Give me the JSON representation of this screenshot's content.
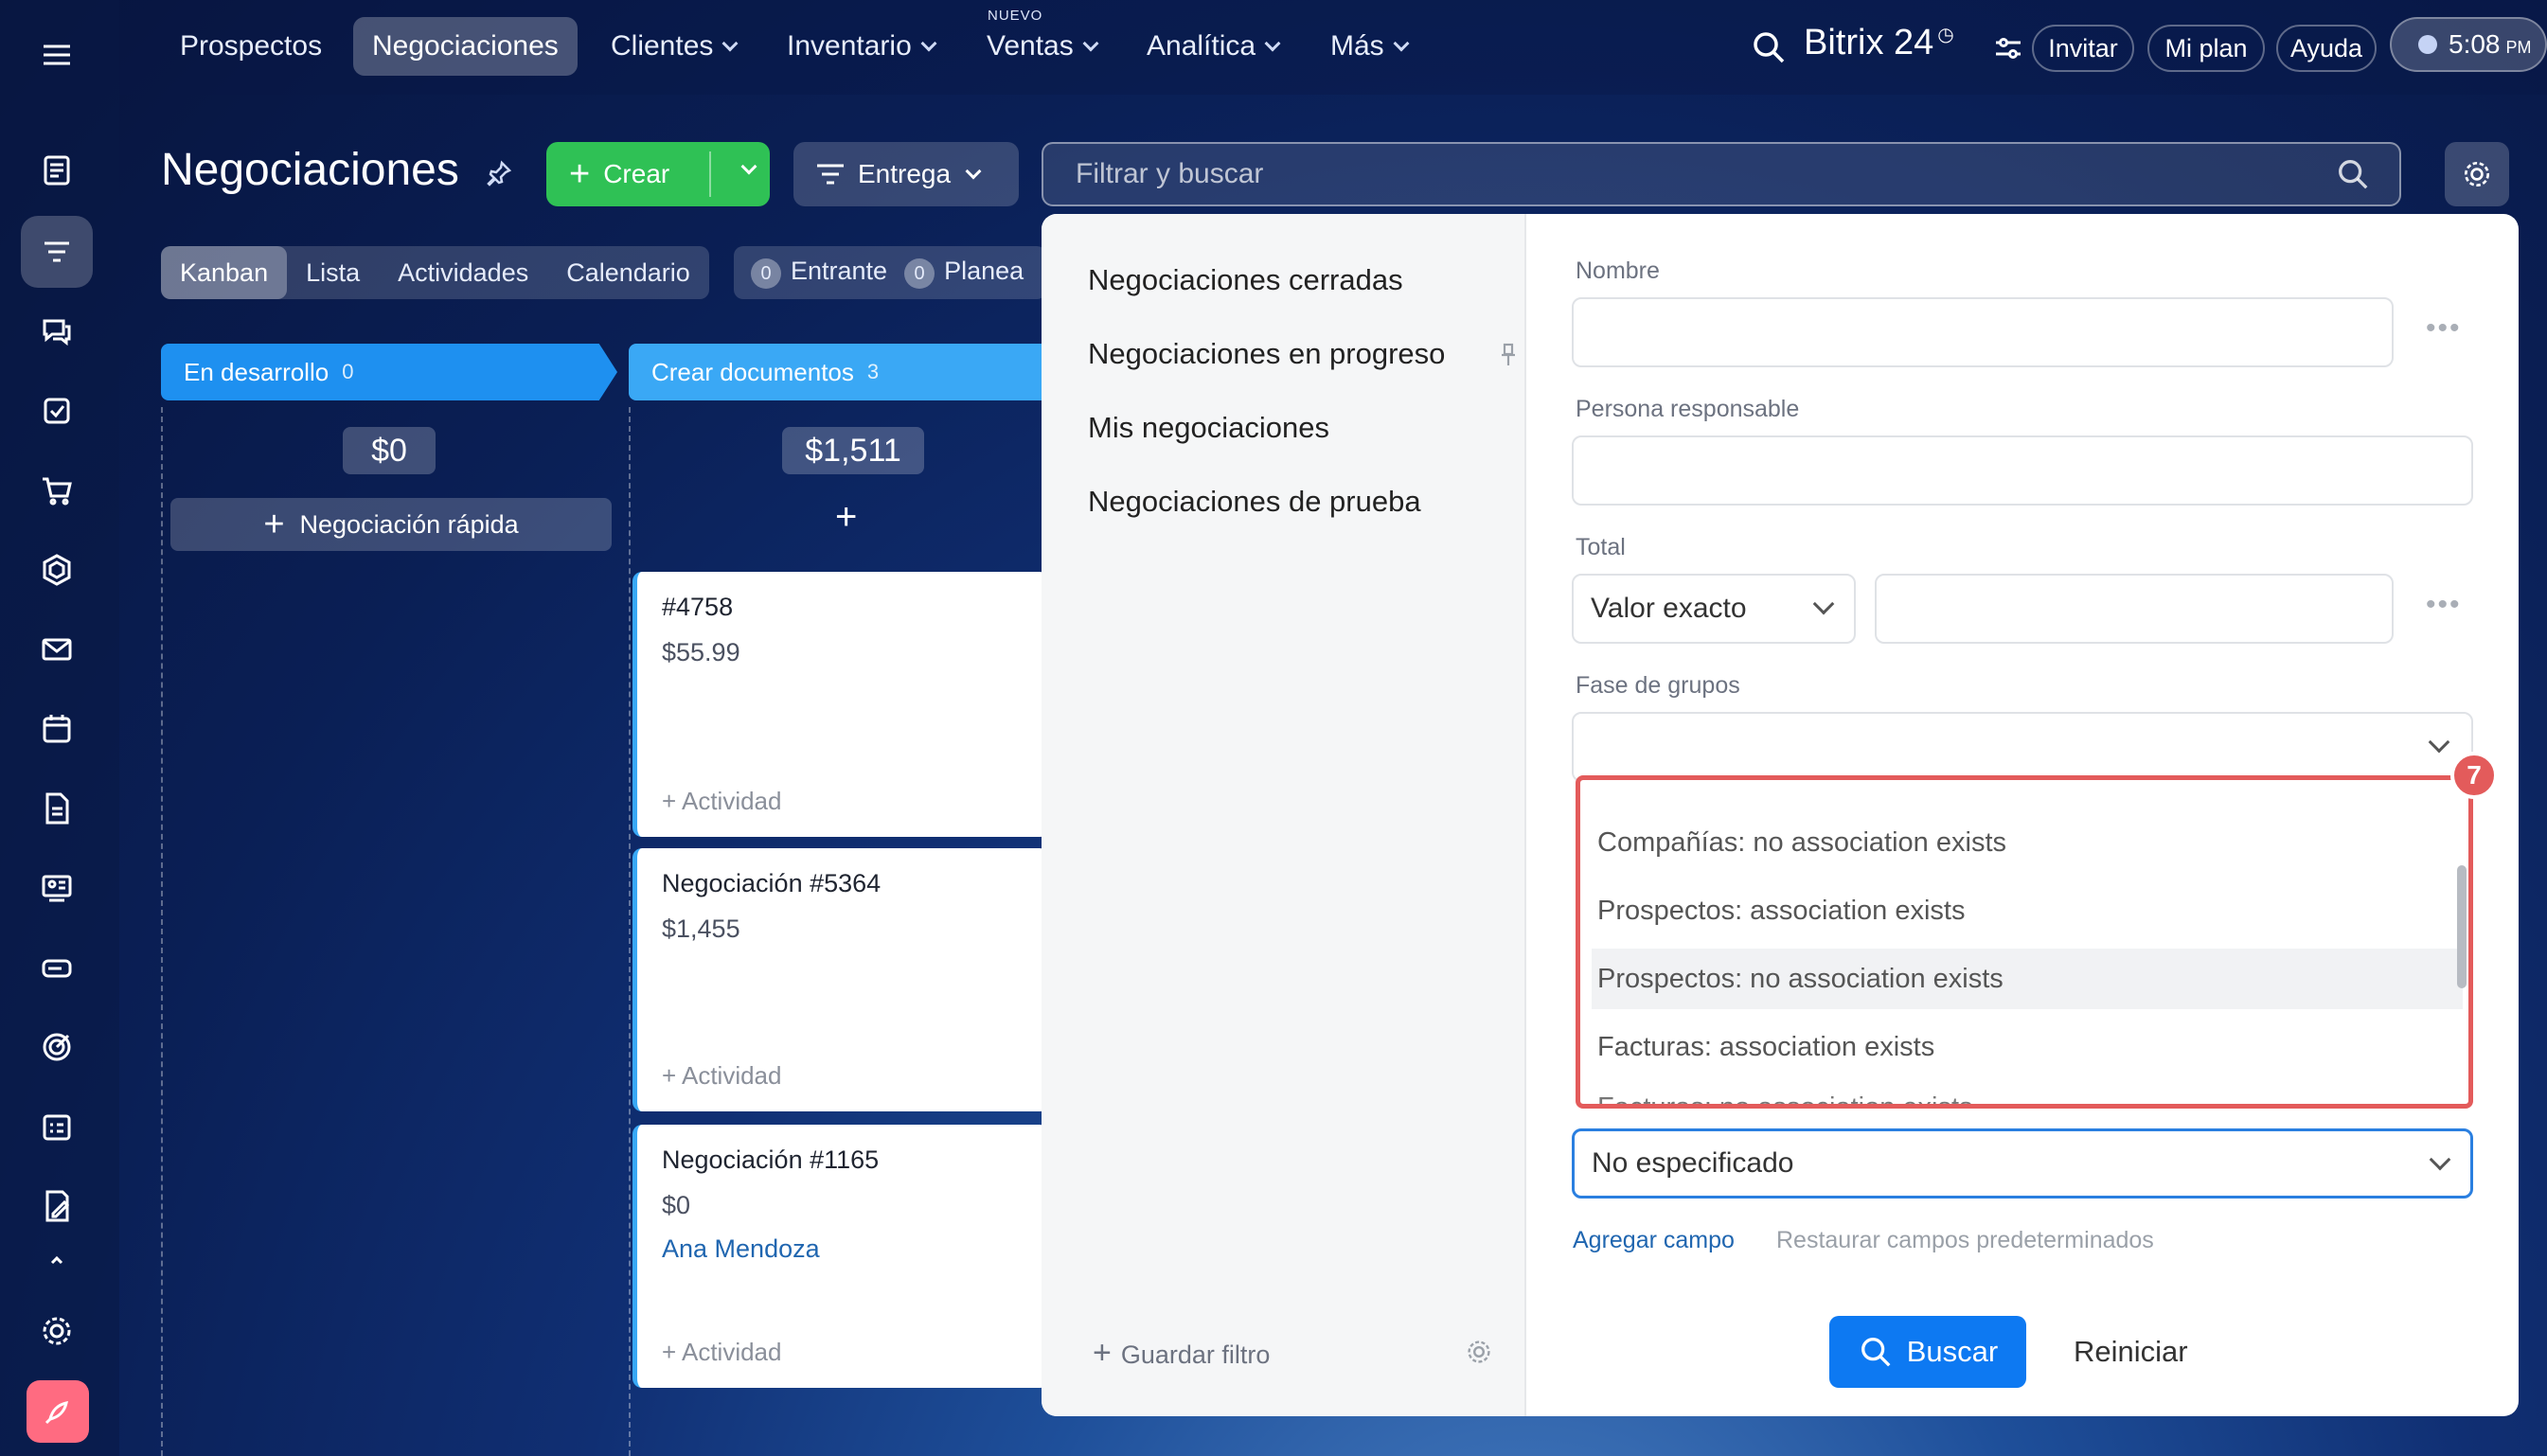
{
  "nav": {
    "items": [
      "Prospectos",
      "Negociaciones",
      "Clientes",
      "Inventario",
      "Ventas",
      "Analítica",
      "Más"
    ],
    "nuevo_label": "NUEVO",
    "brand": "Bitrix 24",
    "invite": "Invitar",
    "plan": "Mi plan",
    "help": "Ayuda",
    "time": "5:08",
    "ampm": "PM"
  },
  "header": {
    "title": "Negociaciones",
    "create_label": "Crear",
    "pipeline_label": "Entrega",
    "search_placeholder": "Filtrar y buscar"
  },
  "view_tabs": [
    "Kanban",
    "Lista",
    "Actividades",
    "Calendario"
  ],
  "counters": [
    {
      "count": "0",
      "label": "Entrante"
    },
    {
      "count": "0",
      "label": "Planea"
    }
  ],
  "kanban": {
    "stages": [
      {
        "name": "En desarrollo",
        "count": "0",
        "sum": "$0"
      },
      {
        "name": "Crear documentos",
        "count": "3",
        "sum": "$1,511"
      }
    ],
    "quick_deal": "Negociación rápida",
    "cards": [
      {
        "title": "#4758",
        "price": "$55.99",
        "contact": "",
        "activity": "+ Actividad"
      },
      {
        "title": "Negociación #5364",
        "price": "$1,455",
        "contact": "",
        "activity": "+ Actividad"
      },
      {
        "title": "Negociación #1165",
        "price": "$0",
        "contact": "Ana Mendoza",
        "activity": "+ Actividad"
      }
    ]
  },
  "filter": {
    "presets": [
      "Negociaciones cerradas",
      "Negociaciones en progreso",
      "Mis negociaciones",
      "Negociaciones de prueba"
    ],
    "save_filter": "Guardar filtro",
    "fields": {
      "name_label": "Nombre",
      "responsible_label": "Persona responsable",
      "total_label": "Total",
      "total_mode": "Valor exacto",
      "group_stage_label": "Fase de grupos",
      "unspecified_value": "No especificado"
    },
    "dropdown_options": [
      "Compañías: no association exists",
      "Prospectos: association exists",
      "Prospectos: no association exists",
      "Facturas: association exists",
      "Facturas: no association exists"
    ],
    "badge": "7",
    "add_field": "Agregar campo",
    "restore_fields": "Restaurar campos predeterminados",
    "search_btn": "Buscar",
    "reset_btn": "Reiniciar"
  },
  "colors": {
    "accent_green": "#2fc155",
    "accent_blue": "#0d79f2",
    "stage_blue": "#1e90f0",
    "stage_light_blue": "#3aa8f5",
    "highlight_red": "#e35b5b"
  }
}
